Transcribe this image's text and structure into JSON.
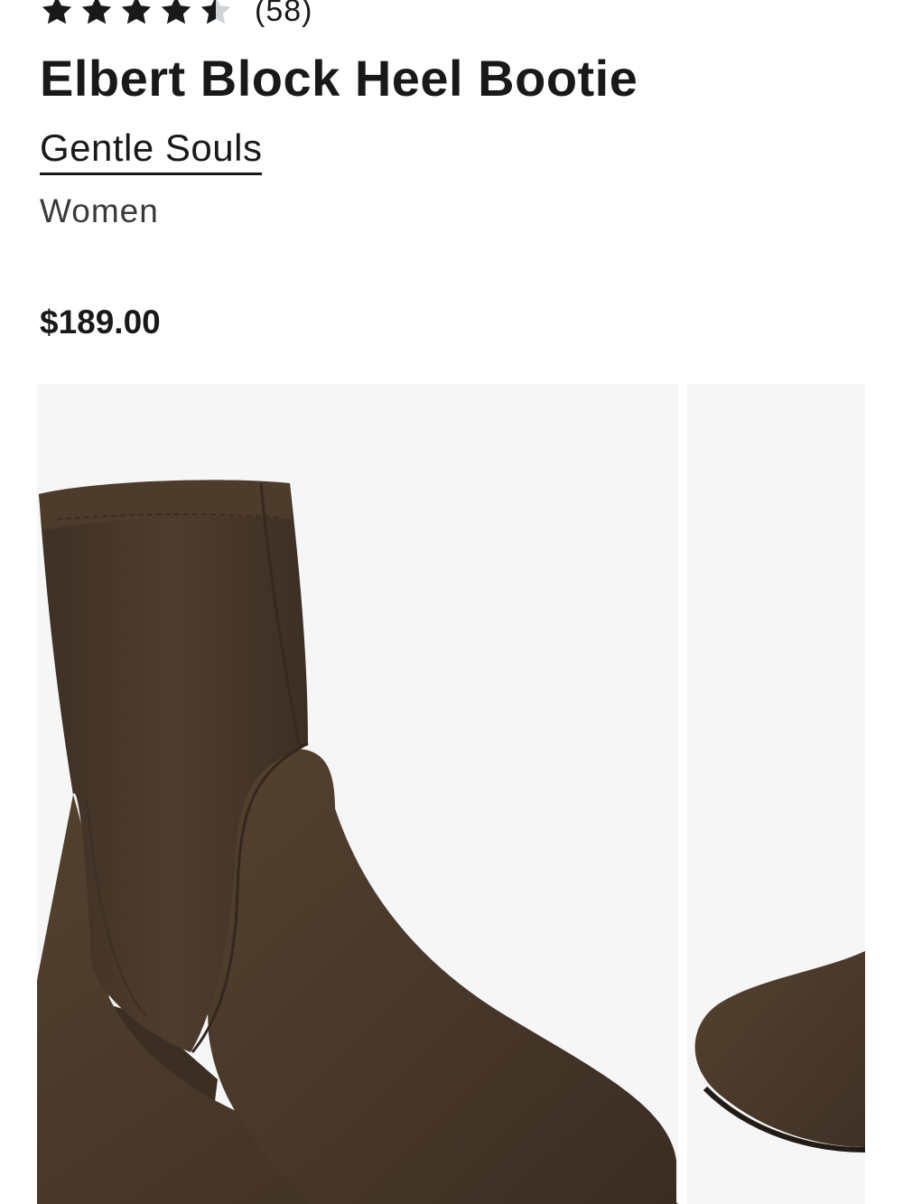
{
  "product": {
    "rating": {
      "value": 4.5,
      "max": 5,
      "count_label": "(58)"
    },
    "title": "Elbert Block Heel Bootie",
    "brand": "Gentle Souls",
    "gender": "Women",
    "price": "$189.00"
  },
  "gallery": {
    "images": [
      {
        "name": "brown suede block heel bootie - side view"
      },
      {
        "name": "brown suede block heel bootie - toe view"
      }
    ]
  },
  "colors": {
    "text": "#191919",
    "star_filled": "#191919",
    "star_empty": "#cfd3d6",
    "image_background": "#f6f6f6",
    "suede_brown": "#4a3a2c"
  }
}
